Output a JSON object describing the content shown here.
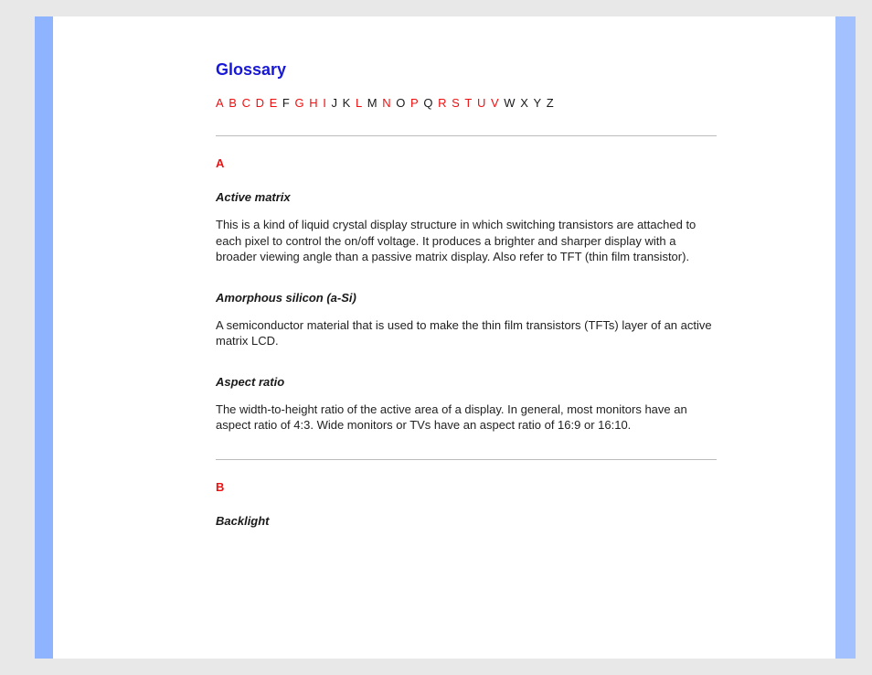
{
  "title": "Glossary",
  "alpha": [
    {
      "label": "A",
      "active": true
    },
    {
      "label": "B",
      "active": true
    },
    {
      "label": "C",
      "active": true
    },
    {
      "label": "D",
      "active": true
    },
    {
      "label": "E",
      "active": true
    },
    {
      "label": "F",
      "active": false
    },
    {
      "label": "G",
      "active": true
    },
    {
      "label": "H",
      "active": true
    },
    {
      "label": "I",
      "active": true
    },
    {
      "label": "J",
      "active": false
    },
    {
      "label": "K",
      "active": false
    },
    {
      "label": "L",
      "active": true
    },
    {
      "label": "M",
      "active": false
    },
    {
      "label": "N",
      "active": true
    },
    {
      "label": "O",
      "active": false
    },
    {
      "label": "P",
      "active": true
    },
    {
      "label": "Q",
      "active": false
    },
    {
      "label": "R",
      "active": true
    },
    {
      "label": "S",
      "active": true
    },
    {
      "label": "T",
      "active": true
    },
    {
      "label": "U",
      "active": true
    },
    {
      "label": "V",
      "active": true
    },
    {
      "label": "W",
      "active": false
    },
    {
      "label": "X",
      "active": false
    },
    {
      "label": "Y",
      "active": false
    },
    {
      "label": "Z",
      "active": false
    }
  ],
  "sections": {
    "A": {
      "letter": "A",
      "entries": [
        {
          "term": "Active matrix",
          "body": "This is a kind of liquid crystal display structure in which switching transistors are attached to each pixel to control the on/off voltage. It produces a brighter and sharper display with a broader viewing angle than a passive matrix display. Also refer to TFT (thin film transistor)."
        },
        {
          "term": "Amorphous silicon (a-Si)",
          "body": "A semiconductor material that is used to make the thin film transistors (TFTs) layer of an active matrix LCD."
        },
        {
          "term": "Aspect ratio",
          "body": "The width-to-height ratio of the active area of a display. In general, most monitors have an aspect ratio of 4:3. Wide monitors or TVs have an aspect ratio of 16:9 or 16:10."
        }
      ]
    },
    "B": {
      "letter": "B",
      "entries": [
        {
          "term": "Backlight",
          "body": ""
        }
      ]
    }
  }
}
